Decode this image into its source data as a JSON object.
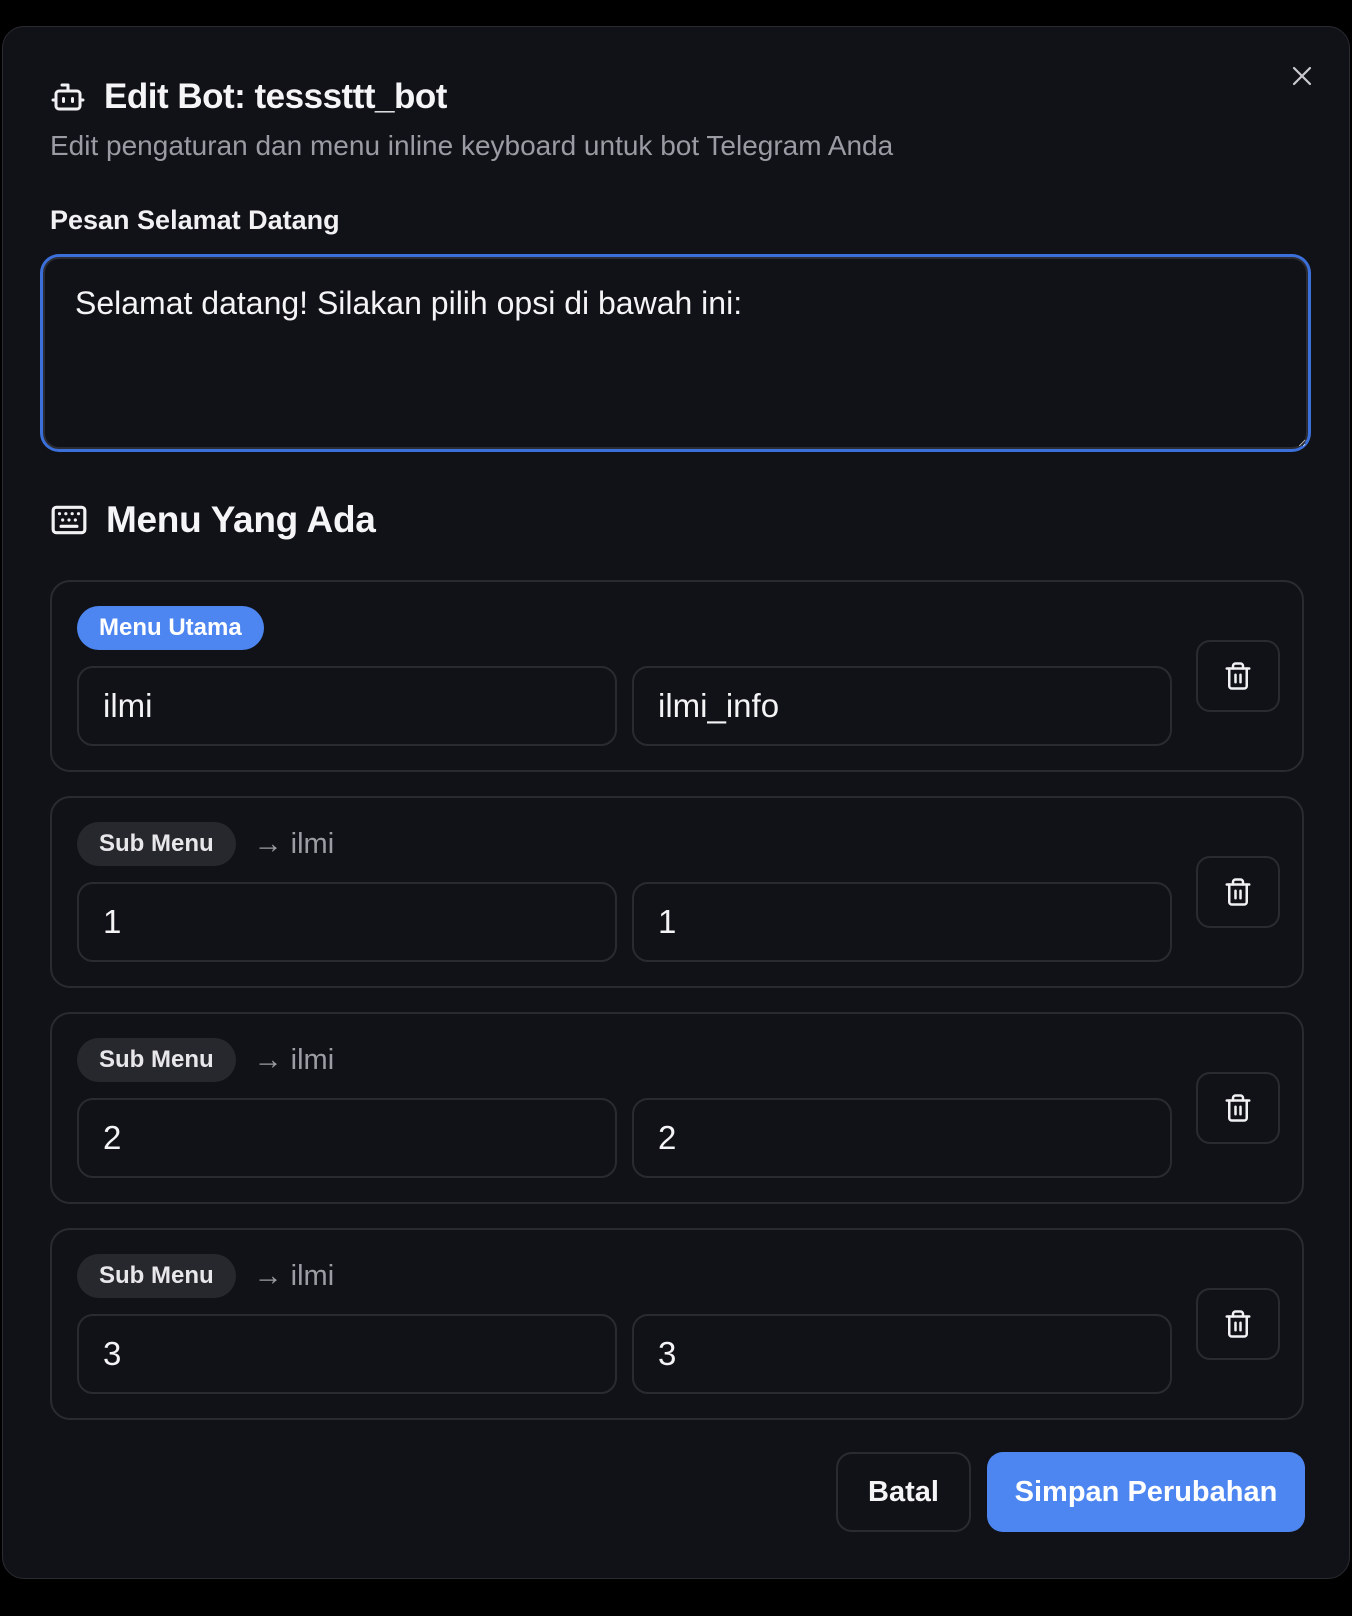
{
  "dialog": {
    "title": "Edit Bot: tesssttt_bot",
    "subtitle": "Edit pengaturan dan menu inline keyboard untuk bot Telegram Anda",
    "title_icon": "bot-icon",
    "close_icon": "close-icon"
  },
  "welcome": {
    "label": "Pesan Selamat Datang",
    "value": "Selamat datang! Silakan pilih opsi di bawah ini:"
  },
  "menus_section": {
    "title": "Menu Yang Ada",
    "icon": "keyboard-icon",
    "items": [
      {
        "badge": "Menu Utama",
        "type": "primary",
        "parent": "",
        "text": "ilmi",
        "callback": "ilmi_info"
      },
      {
        "badge": "Sub Menu",
        "type": "secondary",
        "parent_arrow": "→",
        "parent": "ilmi",
        "text": "1",
        "callback": "1"
      },
      {
        "badge": "Sub Menu",
        "type": "secondary",
        "parent_arrow": "→",
        "parent": "ilmi",
        "text": "2",
        "callback": "2"
      },
      {
        "badge": "Sub Menu",
        "type": "secondary",
        "parent_arrow": "→",
        "parent": "ilmi",
        "text": "3",
        "callback": "3"
      }
    ]
  },
  "footer": {
    "cancel_label": "Batal",
    "save_label": "Simpan Perubahan"
  },
  "colors": {
    "accent": "#4d86f0",
    "focus_ring": "#3b6fd9",
    "background": "#111217",
    "border": "#2a2b31"
  }
}
